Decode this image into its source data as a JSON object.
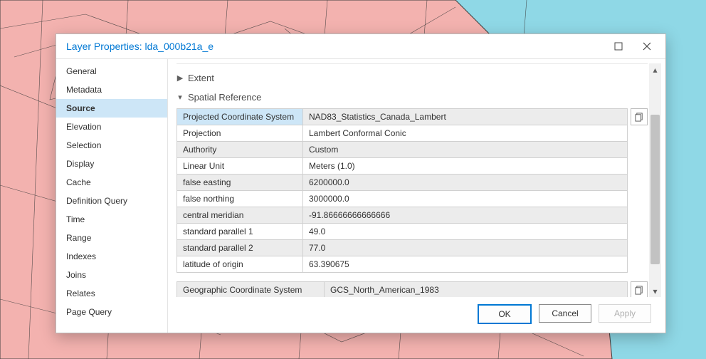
{
  "dialog": {
    "title": "Layer Properties: lda_000b21a_e"
  },
  "sidebar": {
    "items": [
      {
        "label": "General"
      },
      {
        "label": "Metadata"
      },
      {
        "label": "Source"
      },
      {
        "label": "Elevation"
      },
      {
        "label": "Selection"
      },
      {
        "label": "Display"
      },
      {
        "label": "Cache"
      },
      {
        "label": "Definition Query"
      },
      {
        "label": "Time"
      },
      {
        "label": "Range"
      },
      {
        "label": "Indexes"
      },
      {
        "label": "Joins"
      },
      {
        "label": "Relates"
      },
      {
        "label": "Page Query"
      }
    ],
    "selected_index": 2
  },
  "sections": {
    "extent_label": "Extent",
    "spatial_ref_label": "Spatial Reference"
  },
  "spatial_reference": {
    "rows": [
      {
        "k": "Projected Coordinate System",
        "v": "NAD83_Statistics_Canada_Lambert"
      },
      {
        "k": "Projection",
        "v": "Lambert Conformal Conic"
      },
      {
        "k": "Authority",
        "v": "Custom"
      },
      {
        "k": "Linear Unit",
        "v": "Meters (1.0)"
      },
      {
        "k": "false easting",
        "v": "6200000.0"
      },
      {
        "k": "false northing",
        "v": "3000000.0"
      },
      {
        "k": "central meridian",
        "v": "-91.86666666666666"
      },
      {
        "k": "standard parallel 1",
        "v": "49.0"
      },
      {
        "k": "standard parallel 2",
        "v": "77.0"
      },
      {
        "k": "latitude of origin",
        "v": "63.390675"
      }
    ]
  },
  "gcs": {
    "rows": [
      {
        "k": "Geographic Coordinate System",
        "v": "GCS_North_American_1983"
      }
    ]
  },
  "buttons": {
    "ok": "OK",
    "cancel": "Cancel",
    "apply": "Apply"
  }
}
